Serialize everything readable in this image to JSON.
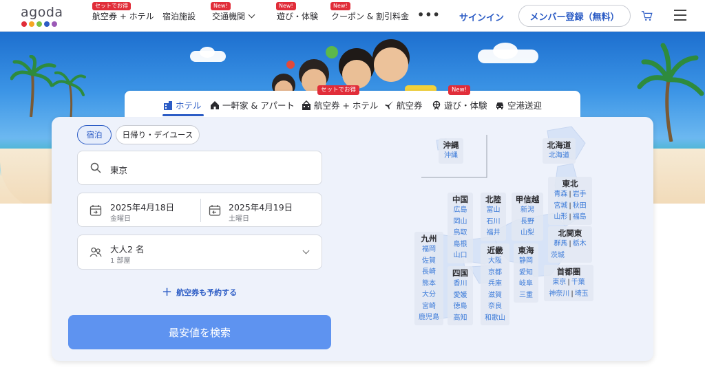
{
  "header": {
    "logo": "agoda",
    "logo_colors": [
      "#e12d39",
      "#f5a623",
      "#7ac143",
      "#2c5cc5",
      "#9b59b6"
    ],
    "nav": [
      {
        "label": "航空券 + ホテル",
        "badge": "セットでお得"
      },
      {
        "label": "宿泊施設"
      },
      {
        "label": "交通機関",
        "badge": "New!"
      },
      {
        "label": "遊び・体験",
        "badge": "New!"
      },
      {
        "label": "クーポン & 割引料金",
        "badge": "New!"
      }
    ],
    "more": "•••",
    "signin": "サインイン",
    "register": "メンバー登録（無料）"
  },
  "tabs": [
    {
      "label": "ホテル",
      "icon": "hotel-icon"
    },
    {
      "label": "一軒家 & アパート",
      "icon": "house-icon"
    },
    {
      "label": "航空券 + ホテル",
      "icon": "package-icon",
      "badge": "セットでお得"
    },
    {
      "label": "航空券",
      "icon": "plane-icon"
    },
    {
      "label": "遊び・体験",
      "icon": "attractions-icon",
      "badge": "New!"
    },
    {
      "label": "空港送迎",
      "icon": "car-icon"
    }
  ],
  "search": {
    "stay_type": {
      "overnight": "宿泊",
      "dayuse": "日帰り・デイユース"
    },
    "destination": "東京",
    "checkin": {
      "date": "2025年4月18日",
      "day": "金曜日"
    },
    "checkout": {
      "date": "2025年4月19日",
      "day": "土曜日"
    },
    "guests": {
      "summary": "大人2 名",
      "rooms": "1 部屋"
    },
    "add_flight": "航空券も予約する",
    "submit": "最安値を検索"
  },
  "map": {
    "okinawa": {
      "title": "沖縄",
      "prefs": [
        "沖縄"
      ]
    },
    "hokkaido": {
      "title": "北海道",
      "prefs": [
        "北海道"
      ]
    },
    "tohoku": {
      "title": "東北",
      "rows": [
        [
          "青森",
          "岩手"
        ],
        [
          "宮城",
          "秋田"
        ],
        [
          "山形",
          "福島"
        ]
      ]
    },
    "chugoku": {
      "title": "中国",
      "prefs": [
        "広島",
        "岡山",
        "鳥取",
        "島根",
        "山口"
      ]
    },
    "hokuriku": {
      "title": "北陸",
      "prefs": [
        "富山",
        "石川",
        "福井"
      ]
    },
    "koshinetsu": {
      "title": "甲信越",
      "prefs": [
        "新潟",
        "長野",
        "山梨"
      ]
    },
    "kitakanto": {
      "title": "北関東",
      "rows": [
        [
          "群馬",
          "栃木"
        ],
        [
          "茨城"
        ]
      ]
    },
    "kyushu": {
      "title": "九州",
      "prefs": [
        "福岡",
        "佐賀",
        "長崎",
        "熊本",
        "大分",
        "宮崎",
        "鹿児島"
      ]
    },
    "kinki": {
      "title": "近畿",
      "prefs": [
        "大阪",
        "京都",
        "兵庫",
        "滋賀",
        "奈良",
        "和歌山"
      ]
    },
    "tokai": {
      "title": "東海",
      "prefs": [
        "静岡",
        "愛知",
        "岐阜",
        "三重"
      ]
    },
    "shikoku": {
      "title": "四国",
      "prefs": [
        "香川",
        "愛媛",
        "徳島",
        "高知"
      ]
    },
    "shutoken": {
      "title": "首都圏",
      "rows": [
        [
          "東京",
          "千葉"
        ],
        [
          "神奈川",
          "埼玉"
        ]
      ]
    }
  }
}
